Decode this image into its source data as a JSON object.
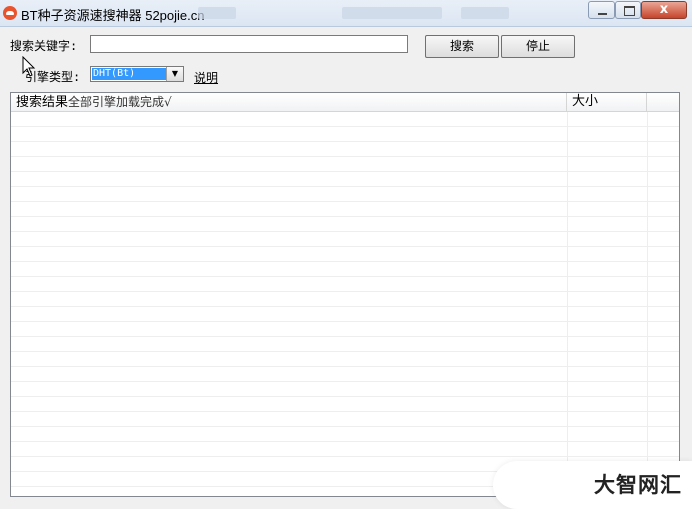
{
  "window": {
    "title": "BT种子资源速搜神器 52pojie.cn",
    "close_glyph": "x",
    "icons": {
      "app": "app-cloud-icon",
      "min": "minimize-icon",
      "max": "maximize-icon",
      "close": "close-icon"
    }
  },
  "search": {
    "keyword_label": "搜索关键字:",
    "keyword_value": "",
    "search_button": "搜索",
    "stop_button": "停止"
  },
  "engine": {
    "label": "引擎类型:",
    "selected": "DHT(Bt)",
    "arrow": "▼",
    "help_link": "说明"
  },
  "results": {
    "columns": [
      {
        "title": "搜索结果",
        "subtitle": "全部引擎加载完成√"
      },
      {
        "title": "大小"
      }
    ],
    "rows": []
  },
  "watermark": {
    "text": "大智网汇"
  },
  "colors": {
    "selection": "#3399ff",
    "close": "#c7452b"
  }
}
